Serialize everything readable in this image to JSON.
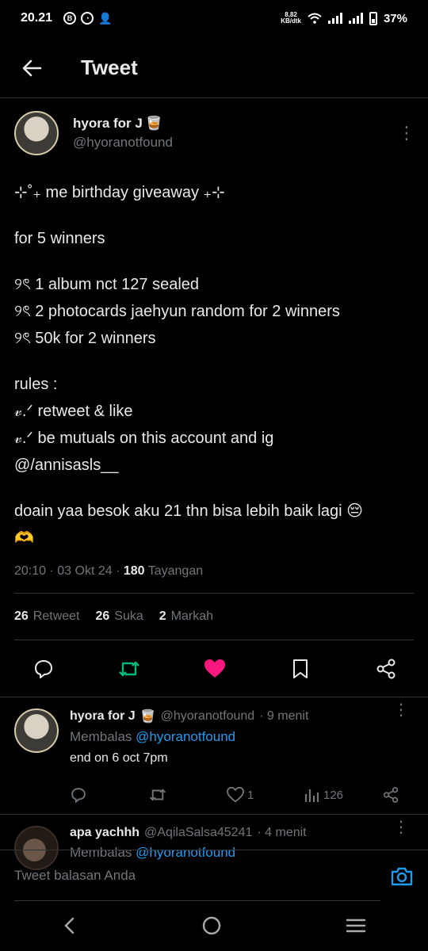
{
  "status_bar": {
    "time": "20.21",
    "net_speed_value": "8,82",
    "net_speed_unit": "KB/dtk",
    "battery": "37%"
  },
  "header": {
    "title": "Tweet"
  },
  "tweet": {
    "author_name": "hyora for J",
    "author_emoji": "🥃",
    "handle": "@hyoranotfound",
    "lines": [
      "⊹˚₊ me birthday giveaway ₊⊹",
      "",
      "for 5 winners",
      "",
      "୨ৎ 1 album nct 127 sealed",
      "୨ৎ 2 photocards jaehyun random for 2 winners",
      "୨ৎ 50k for 2 winners",
      "",
      "rules :",
      "𝓋.ᐟ retweet & like",
      "𝓋.ᐟ be mutuals on this account and ig",
      "@/annisasls__",
      "",
      "doain yaa besok aku 21 thn bisa lebih baik lagi 😔",
      "🫶"
    ],
    "time": "20:10 · 03 Okt 24 · ",
    "views_count": "180",
    "views_label": " Tayangan",
    "retweets_count": "26",
    "retweets_label": "Retweet",
    "likes_count": "26",
    "likes_label": "Suka",
    "bookmarks_count": "2",
    "bookmarks_label": "Markah"
  },
  "replies": [
    {
      "name": "hyora for J",
      "emoji": "🥃",
      "handle": "@hyoranotfound",
      "time": "· 9 menit",
      "replying_prefix": "Membalas",
      "replying_to": "@hyoranotfound",
      "text": "end on 6 oct 7pm",
      "likes": "1",
      "views": "126"
    },
    {
      "name": "apa yachhh",
      "handle": "@AqilaSalsa45241",
      "time": "· 4 menit",
      "replying_prefix": "Membalas",
      "replying_to": "@hyoranotfound"
    }
  ],
  "compose": {
    "placeholder": "Tweet balasan Anda"
  },
  "colors": {
    "accent": "#1d9bf0",
    "retweet": "#00ba7c",
    "like": "#f91880",
    "muted": "#71767b"
  }
}
